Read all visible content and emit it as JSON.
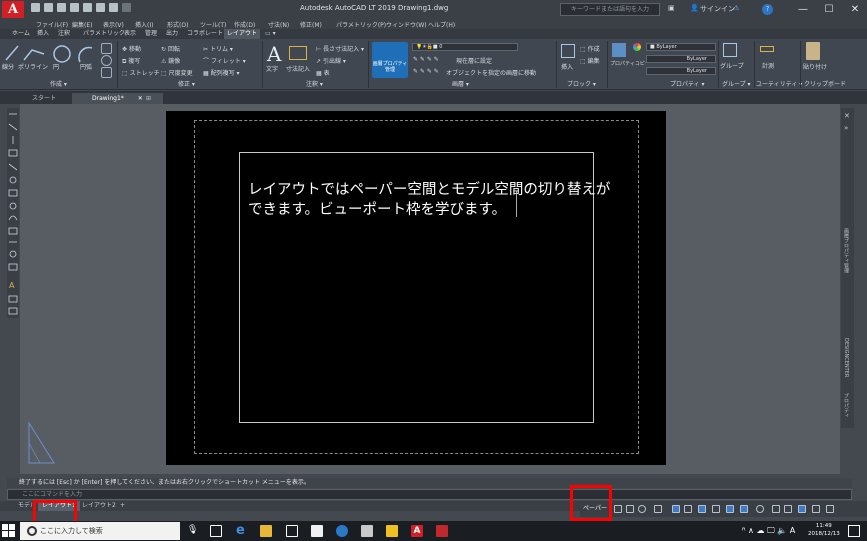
{
  "app": {
    "logo_letter": "A",
    "title": "Autodesk AutoCAD LT 2019    Drawing1.dwg",
    "search_placeholder": "キーワードまたは語句を入力",
    "signin": "サインイン",
    "help": "?"
  },
  "menubar": [
    "ファイル(F)",
    "編集(E)",
    "表示(V)",
    "挿入(I)",
    "形式(O)",
    "ツール(T)",
    "作成(D)",
    "寸法(N)",
    "修正(M)",
    "パラメトリック(P)",
    "ウィンドウ(W)",
    "ヘルプ(H)"
  ],
  "ribbon_tabs": [
    "ホーム",
    "挿入",
    "注釈",
    "パラメトリック",
    "表示",
    "管理",
    "出力",
    "コラボレート",
    "レイアウト"
  ],
  "ribbon": {
    "draw": {
      "line": "線分",
      "polyline": "ポリライン",
      "circle": "円",
      "arc": "円弧",
      "label": "作成 ▾"
    },
    "modify": {
      "move": "移動",
      "rotate": "回転",
      "trim": "トリム ▾",
      "copy": "複写",
      "mirror": "鏡像",
      "fillet": "フィレット ▾",
      "stretch": "ストレッチ",
      "scale": "尺度変更",
      "array": "配列複写 ▾",
      "label": "修正 ▾"
    },
    "annotation": {
      "text": "文字",
      "dimension": "寸法記入",
      "linear": "長さ寸法記入 ▾",
      "leader": "引出線 ▾",
      "table": "表",
      "label": "注釈 ▾"
    },
    "layers": {
      "props": "画層プロパティ管理",
      "layer_value": "0",
      "make_current": "現在層に設定",
      "match": "オブジェクトを指定の画層に移動",
      "label": "画層 ▾"
    },
    "block": {
      "insert": "挿入",
      "create": "作成",
      "edit": "編集",
      "label": "ブロック ▾"
    },
    "properties": {
      "match": "プロパティコピー",
      "bylayer1": "ByLayer",
      "bylayer2": "ByLayer",
      "bylayer3": "ByLayer",
      "label": "プロパティ ▾"
    },
    "groups": {
      "group": "グループ",
      "label": "グループ ▾"
    },
    "utilities": {
      "measure": "計測",
      "label": "ユーティリティ ▾"
    },
    "clipboard": {
      "paste": "貼り付け",
      "label": "クリップボード"
    }
  },
  "doc_tabs": [
    "スタート",
    "Drawing1*"
  ],
  "viewport_text": {
    "line1": "レイアウトではペーパー空間とモデル空間の切り替えが",
    "line2": "できます。ビューポート枠を学びます。"
  },
  "right_palettes": [
    "画層プロパティ管理",
    "DESIGNCENTER",
    "プロパティ"
  ],
  "command": {
    "history": "終了するには [Esc] か [Enter] を押してください、またはお右クリックでショートカット メニューを表示。",
    "placeholder": "ここにコマンドを入力"
  },
  "layout_tabs": [
    "モデル",
    "レイアウト1",
    "レイアウト2",
    "+"
  ],
  "status": {
    "paper": "ペーパー"
  },
  "taskbar": {
    "search": "ここに入力して検索",
    "time": "11:49",
    "date": "2018/12/13",
    "ime": "A"
  },
  "colors": {
    "accent_red": "#ff0000",
    "logo_red": "#d21f26",
    "canvas": "#000000"
  }
}
